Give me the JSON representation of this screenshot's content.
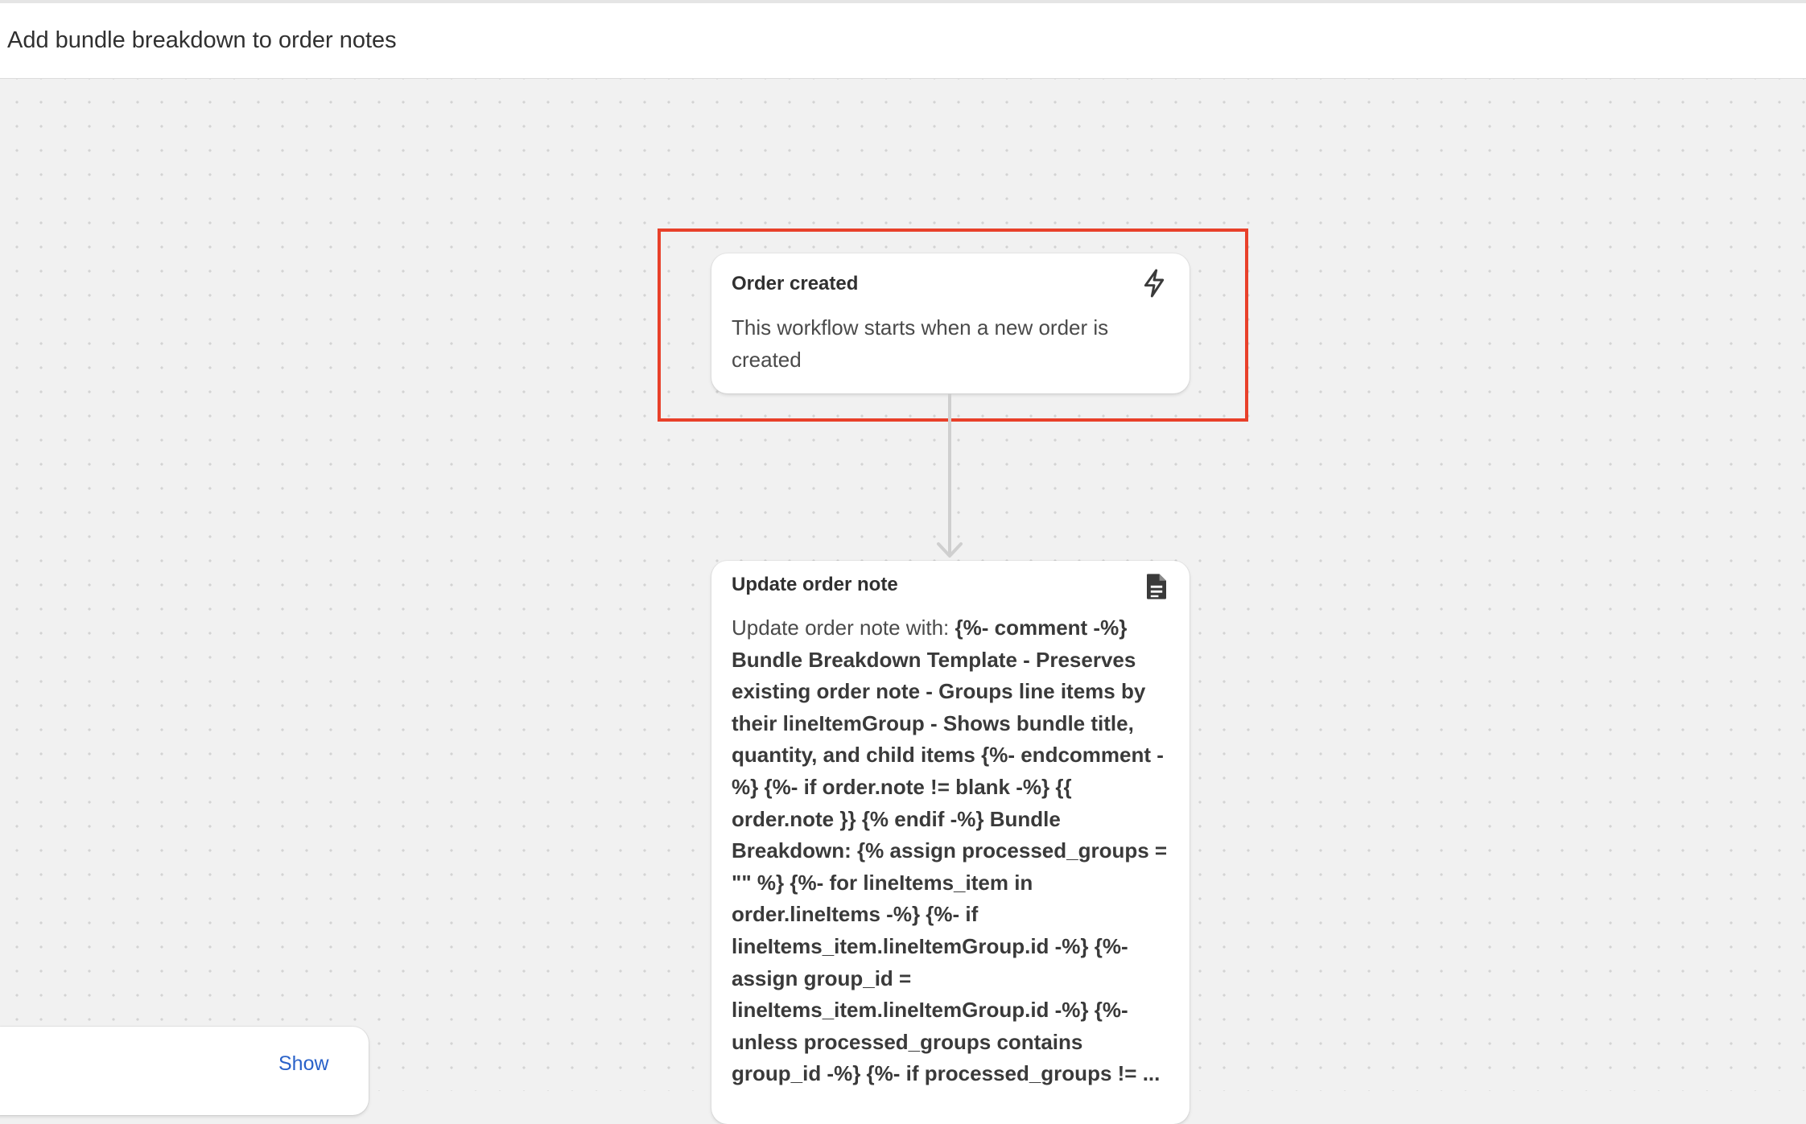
{
  "header": {
    "title": "Add bundle breakdown to order notes"
  },
  "trigger_card": {
    "title": "Order created",
    "icon": "lightning-bolt-icon",
    "description": "This workflow starts when a new order is created"
  },
  "action_card": {
    "title": "Update order note",
    "icon": "document-icon",
    "description_prefix": "Update order note with: ",
    "description_body": "{%- comment -%} Bundle Breakdown Template - Preserves existing order note - Groups line items by their lineItemGroup - Shows bundle title, quantity, and child items {%- endcomment -%} {%- if order.note != blank -%} {{ order.note }}  {% endif -%} Bundle Breakdown: {% assign processed_groups = \"\" %} {%- for lineItems_item in order.lineItems -%} {%- if lineItems_item.lineItemGroup.id -%} {%- assign group_id = lineItems_item.lineItemGroup.id -%} {%- unless processed_groups contains group_id -%} {%- if processed_groups != ..."
  },
  "side_panel": {
    "show_label": "Show"
  },
  "colors": {
    "highlight_border": "#e8402a",
    "link": "#2a62c9",
    "canvas_background": "#f1f1f1",
    "connector": "#cfcfcf"
  }
}
